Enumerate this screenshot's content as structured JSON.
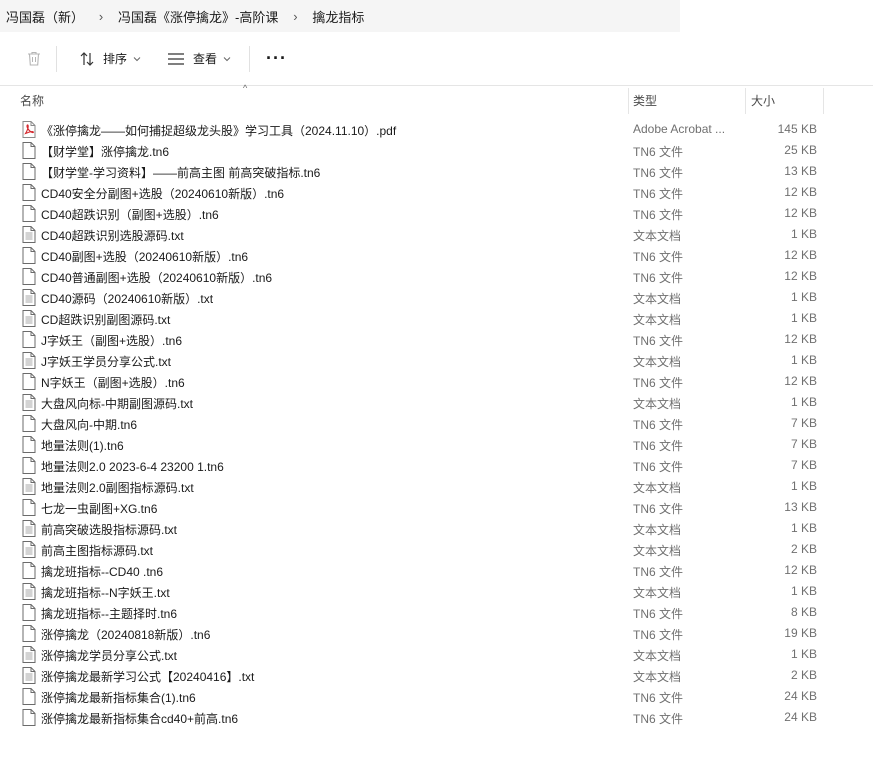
{
  "breadcrumb": {
    "items": [
      "冯国磊（新）",
      "冯国磊《涨停擒龙》-高阶课",
      "擒龙指标"
    ]
  },
  "toolbar": {
    "sort_label": "排序",
    "view_label": "查看",
    "more_label": "···"
  },
  "columns": {
    "name": "名称",
    "type": "类型",
    "size": "大小"
  },
  "files": [
    {
      "name": "《涨停擒龙——如何捕捉超级龙头股》学习工具（2024.11.10）.pdf",
      "type": "Adobe Acrobat ...",
      "size": "145 KB",
      "icon": "pdf-icon"
    },
    {
      "name": "【财学堂】涨停擒龙.tn6",
      "type": "TN6 文件",
      "size": "25 KB",
      "icon": "file-icon"
    },
    {
      "name": "【财学堂-学习资料】——前高主图 前高突破指标.tn6",
      "type": "TN6 文件",
      "size": "13 KB",
      "icon": "file-icon"
    },
    {
      "name": "CD40安全分副图+选股（20240610新版）.tn6",
      "type": "TN6 文件",
      "size": "12 KB",
      "icon": "file-icon"
    },
    {
      "name": "CD40超跌识别（副图+选股）.tn6",
      "type": "TN6 文件",
      "size": "12 KB",
      "icon": "file-icon"
    },
    {
      "name": "CD40超跌识别选股源码.txt",
      "type": "文本文档",
      "size": "1 KB",
      "icon": "text-file-icon"
    },
    {
      "name": "CD40副图+选股（20240610新版）.tn6",
      "type": "TN6 文件",
      "size": "12 KB",
      "icon": "file-icon"
    },
    {
      "name": "CD40普通副图+选股（20240610新版）.tn6",
      "type": "TN6 文件",
      "size": "12 KB",
      "icon": "file-icon"
    },
    {
      "name": "CD40源码（20240610新版）.txt",
      "type": "文本文档",
      "size": "1 KB",
      "icon": "text-file-icon"
    },
    {
      "name": "CD超跌识别副图源码.txt",
      "type": "文本文档",
      "size": "1 KB",
      "icon": "text-file-icon"
    },
    {
      "name": "J字妖王（副图+选股）.tn6",
      "type": "TN6 文件",
      "size": "12 KB",
      "icon": "file-icon"
    },
    {
      "name": "J字妖王学员分享公式.txt",
      "type": "文本文档",
      "size": "1 KB",
      "icon": "text-file-icon"
    },
    {
      "name": "N字妖王（副图+选股）.tn6",
      "type": "TN6 文件",
      "size": "12 KB",
      "icon": "file-icon"
    },
    {
      "name": "大盘风向标-中期副图源码.txt",
      "type": "文本文档",
      "size": "1 KB",
      "icon": "text-file-icon"
    },
    {
      "name": "大盘风向-中期.tn6",
      "type": "TN6 文件",
      "size": "7 KB",
      "icon": "file-icon"
    },
    {
      "name": "地量法则(1).tn6",
      "type": "TN6 文件",
      "size": "7 KB",
      "icon": "file-icon"
    },
    {
      "name": "地量法则2.0 2023-6-4 23200 1.tn6",
      "type": "TN6 文件",
      "size": "7 KB",
      "icon": "file-icon"
    },
    {
      "name": "地量法则2.0副图指标源码.txt",
      "type": "文本文档",
      "size": "1 KB",
      "icon": "text-file-icon"
    },
    {
      "name": "七龙一虫副图+XG.tn6",
      "type": "TN6 文件",
      "size": "13 KB",
      "icon": "file-icon"
    },
    {
      "name": "前高突破选股指标源码.txt",
      "type": "文本文档",
      "size": "1 KB",
      "icon": "text-file-icon"
    },
    {
      "name": "前高主图指标源码.txt",
      "type": "文本文档",
      "size": "2 KB",
      "icon": "text-file-icon"
    },
    {
      "name": "擒龙班指标--CD40 .tn6",
      "type": "TN6 文件",
      "size": "12 KB",
      "icon": "file-icon"
    },
    {
      "name": "擒龙班指标--N字妖王.txt",
      "type": "文本文档",
      "size": "1 KB",
      "icon": "text-file-icon"
    },
    {
      "name": "擒龙班指标--主题择时.tn6",
      "type": "TN6 文件",
      "size": "8 KB",
      "icon": "file-icon"
    },
    {
      "name": "涨停擒龙（20240818新版）.tn6",
      "type": "TN6 文件",
      "size": "19 KB",
      "icon": "file-icon"
    },
    {
      "name": "涨停擒龙学员分享公式.txt",
      "type": "文本文档",
      "size": "1 KB",
      "icon": "text-file-icon"
    },
    {
      "name": "涨停擒龙最新学习公式【20240416】.txt",
      "type": "文本文档",
      "size": "2 KB",
      "icon": "text-file-icon"
    },
    {
      "name": "涨停擒龙最新指标集合(1).tn6",
      "type": "TN6 文件",
      "size": "24 KB",
      "icon": "file-icon"
    },
    {
      "name": "涨停擒龙最新指标集合cd40+前高.tn6",
      "type": "TN6 文件",
      "size": "24 KB",
      "icon": "file-icon"
    }
  ]
}
